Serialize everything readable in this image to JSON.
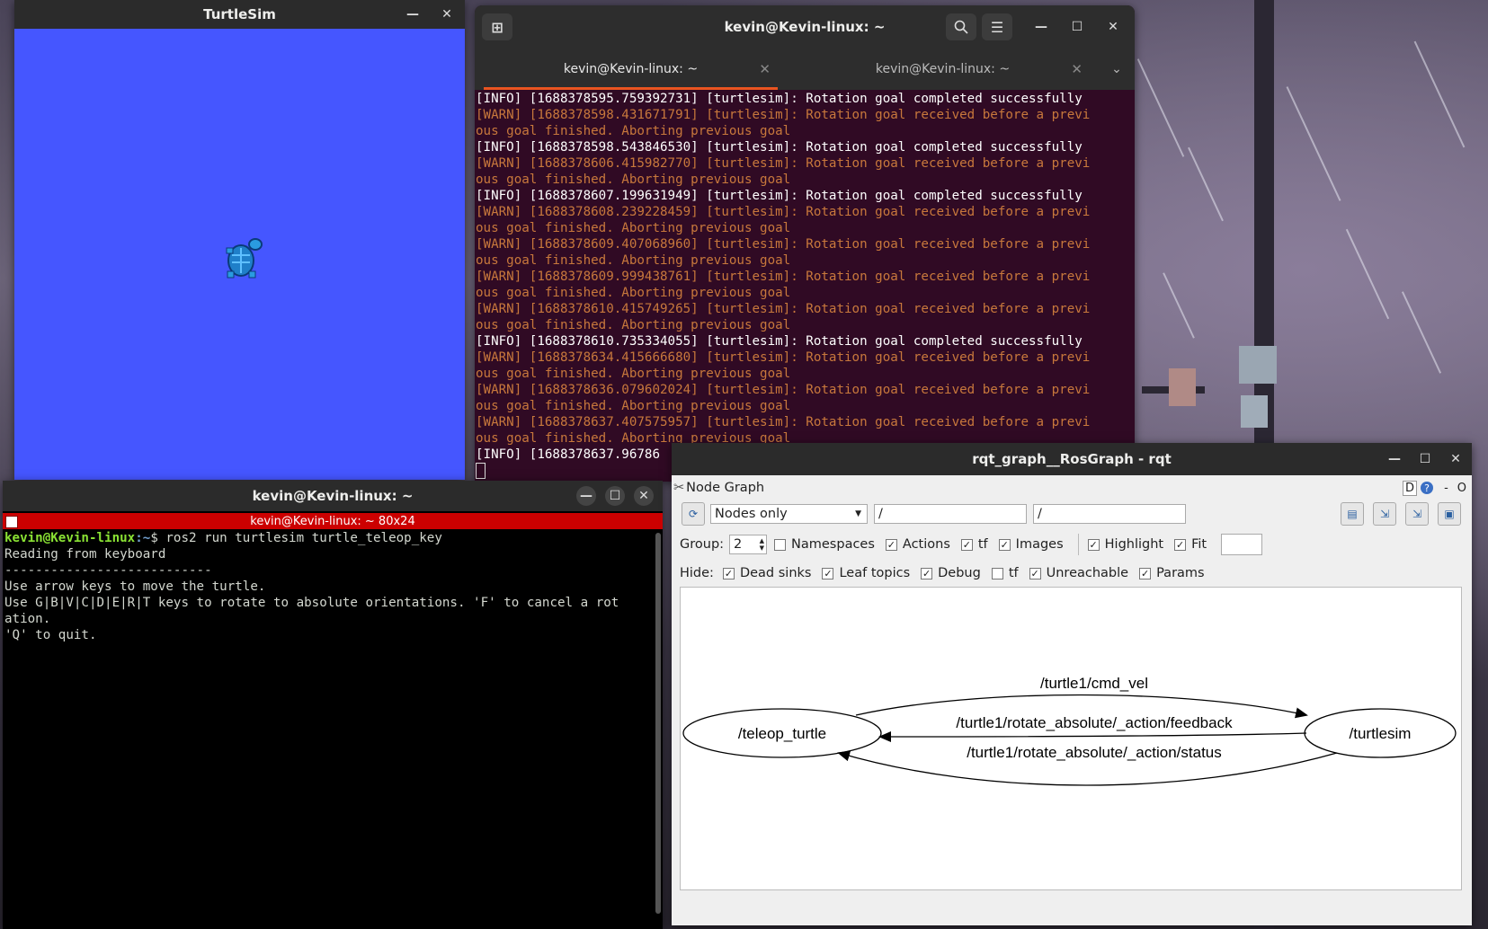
{
  "turtlesim": {
    "title": "TurtleSim",
    "bg_color": "#4556ff"
  },
  "terminal1": {
    "title": "kevin@Kevin-linux: ~",
    "tabs": [
      {
        "label": "kevin@Kevin-linux: ~",
        "active": true
      },
      {
        "label": "kevin@Kevin-linux: ~",
        "active": false
      }
    ],
    "log_lines": [
      {
        "level": "info",
        "text": "[INFO] [1688378595.759392731] [turtlesim]: Rotation goal completed successfully"
      },
      {
        "level": "warn",
        "text": "[WARN] [1688378598.431671791] [turtlesim]: Rotation goal received before a previ"
      },
      {
        "level": "warn",
        "text": "ous goal finished. Aborting previous goal"
      },
      {
        "level": "info",
        "text": "[INFO] [1688378598.543846530] [turtlesim]: Rotation goal completed successfully"
      },
      {
        "level": "warn",
        "text": "[WARN] [1688378606.415982770] [turtlesim]: Rotation goal received before a previ"
      },
      {
        "level": "warn",
        "text": "ous goal finished. Aborting previous goal"
      },
      {
        "level": "info",
        "text": "[INFO] [1688378607.199631949] [turtlesim]: Rotation goal completed successfully"
      },
      {
        "level": "warn",
        "text": "[WARN] [1688378608.239228459] [turtlesim]: Rotation goal received before a previ"
      },
      {
        "level": "warn",
        "text": "ous goal finished. Aborting previous goal"
      },
      {
        "level": "warn",
        "text": "[WARN] [1688378609.407068960] [turtlesim]: Rotation goal received before a previ"
      },
      {
        "level": "warn",
        "text": "ous goal finished. Aborting previous goal"
      },
      {
        "level": "warn",
        "text": "[WARN] [1688378609.999438761] [turtlesim]: Rotation goal received before a previ"
      },
      {
        "level": "warn",
        "text": "ous goal finished. Aborting previous goal"
      },
      {
        "level": "warn",
        "text": "[WARN] [1688378610.415749265] [turtlesim]: Rotation goal received before a previ"
      },
      {
        "level": "warn",
        "text": "ous goal finished. Aborting previous goal"
      },
      {
        "level": "info",
        "text": "[INFO] [1688378610.735334055] [turtlesim]: Rotation goal completed successfully"
      },
      {
        "level": "warn",
        "text": "[WARN] [1688378634.415666680] [turtlesim]: Rotation goal received before a previ"
      },
      {
        "level": "warn",
        "text": "ous goal finished. Aborting previous goal"
      },
      {
        "level": "warn",
        "text": "[WARN] [1688378636.079602024] [turtlesim]: Rotation goal received before a previ"
      },
      {
        "level": "warn",
        "text": "ous goal finished. Aborting previous goal"
      },
      {
        "level": "warn",
        "text": "[WARN] [1688378637.407575957] [turtlesim]: Rotation goal received before a previ"
      },
      {
        "level": "warn",
        "text": "ous goal finished. Aborting previous goal"
      },
      {
        "level": "info",
        "text": "[INFO] [1688378637.96786"
      }
    ],
    "colors": {
      "bg": "#300a24",
      "info": "#ffffff",
      "warn": "#c8783c",
      "tab_accent": "#e95420"
    }
  },
  "terminal2": {
    "title": "kevin@Kevin-linux: ~",
    "subtitle": "kevin@Kevin-linux: ~ 80x24",
    "prompt_user": "kevin@Kevin-linux",
    "prompt_path": ":~",
    "prompt_suffix": "$ ros2 run turtlesim turtle_teleop_key",
    "output_lines": [
      "Reading from keyboard",
      "---------------------------",
      "Use arrow keys to move the turtle.",
      "Use G|B|V|C|D|E|R|T keys to rotate to absolute orientations. 'F' to cancel a rot",
      "ation.",
      "'Q' to quit."
    ]
  },
  "rqt": {
    "title": "rqt_graph__RosGraph - rqt",
    "plugin_title": "Node Graph",
    "plugin_buttons": {
      "d": "D",
      "help": "?",
      "minus": "-",
      "o": "O"
    },
    "mode_select": "Nodes only",
    "filter1": "/",
    "filter2": "/",
    "group_label": "Group:",
    "group_value": "2",
    "row1_checks": [
      {
        "label": "Namespaces",
        "checked": false
      },
      {
        "label": "Actions",
        "checked": true
      },
      {
        "label": "tf",
        "checked": true
      },
      {
        "label": "Images",
        "checked": true
      }
    ],
    "row1_checks_b": [
      {
        "label": "Highlight",
        "checked": true
      },
      {
        "label": "Fit",
        "checked": true
      }
    ],
    "hide_label": "Hide:",
    "hide_checks": [
      {
        "label": "Dead sinks",
        "checked": true
      },
      {
        "label": "Leaf topics",
        "checked": true
      },
      {
        "label": "Debug",
        "checked": true
      },
      {
        "label": "tf",
        "checked": false
      },
      {
        "label": "Unreachable",
        "checked": true
      },
      {
        "label": "Params",
        "checked": true
      }
    ],
    "graph": {
      "nodes": [
        "/teleop_turtle",
        "/turtlesim"
      ],
      "edges": [
        "/turtle1/cmd_vel",
        "/turtle1/rotate_absolute/_action/feedback",
        "/turtle1/rotate_absolute/_action/status"
      ]
    }
  }
}
